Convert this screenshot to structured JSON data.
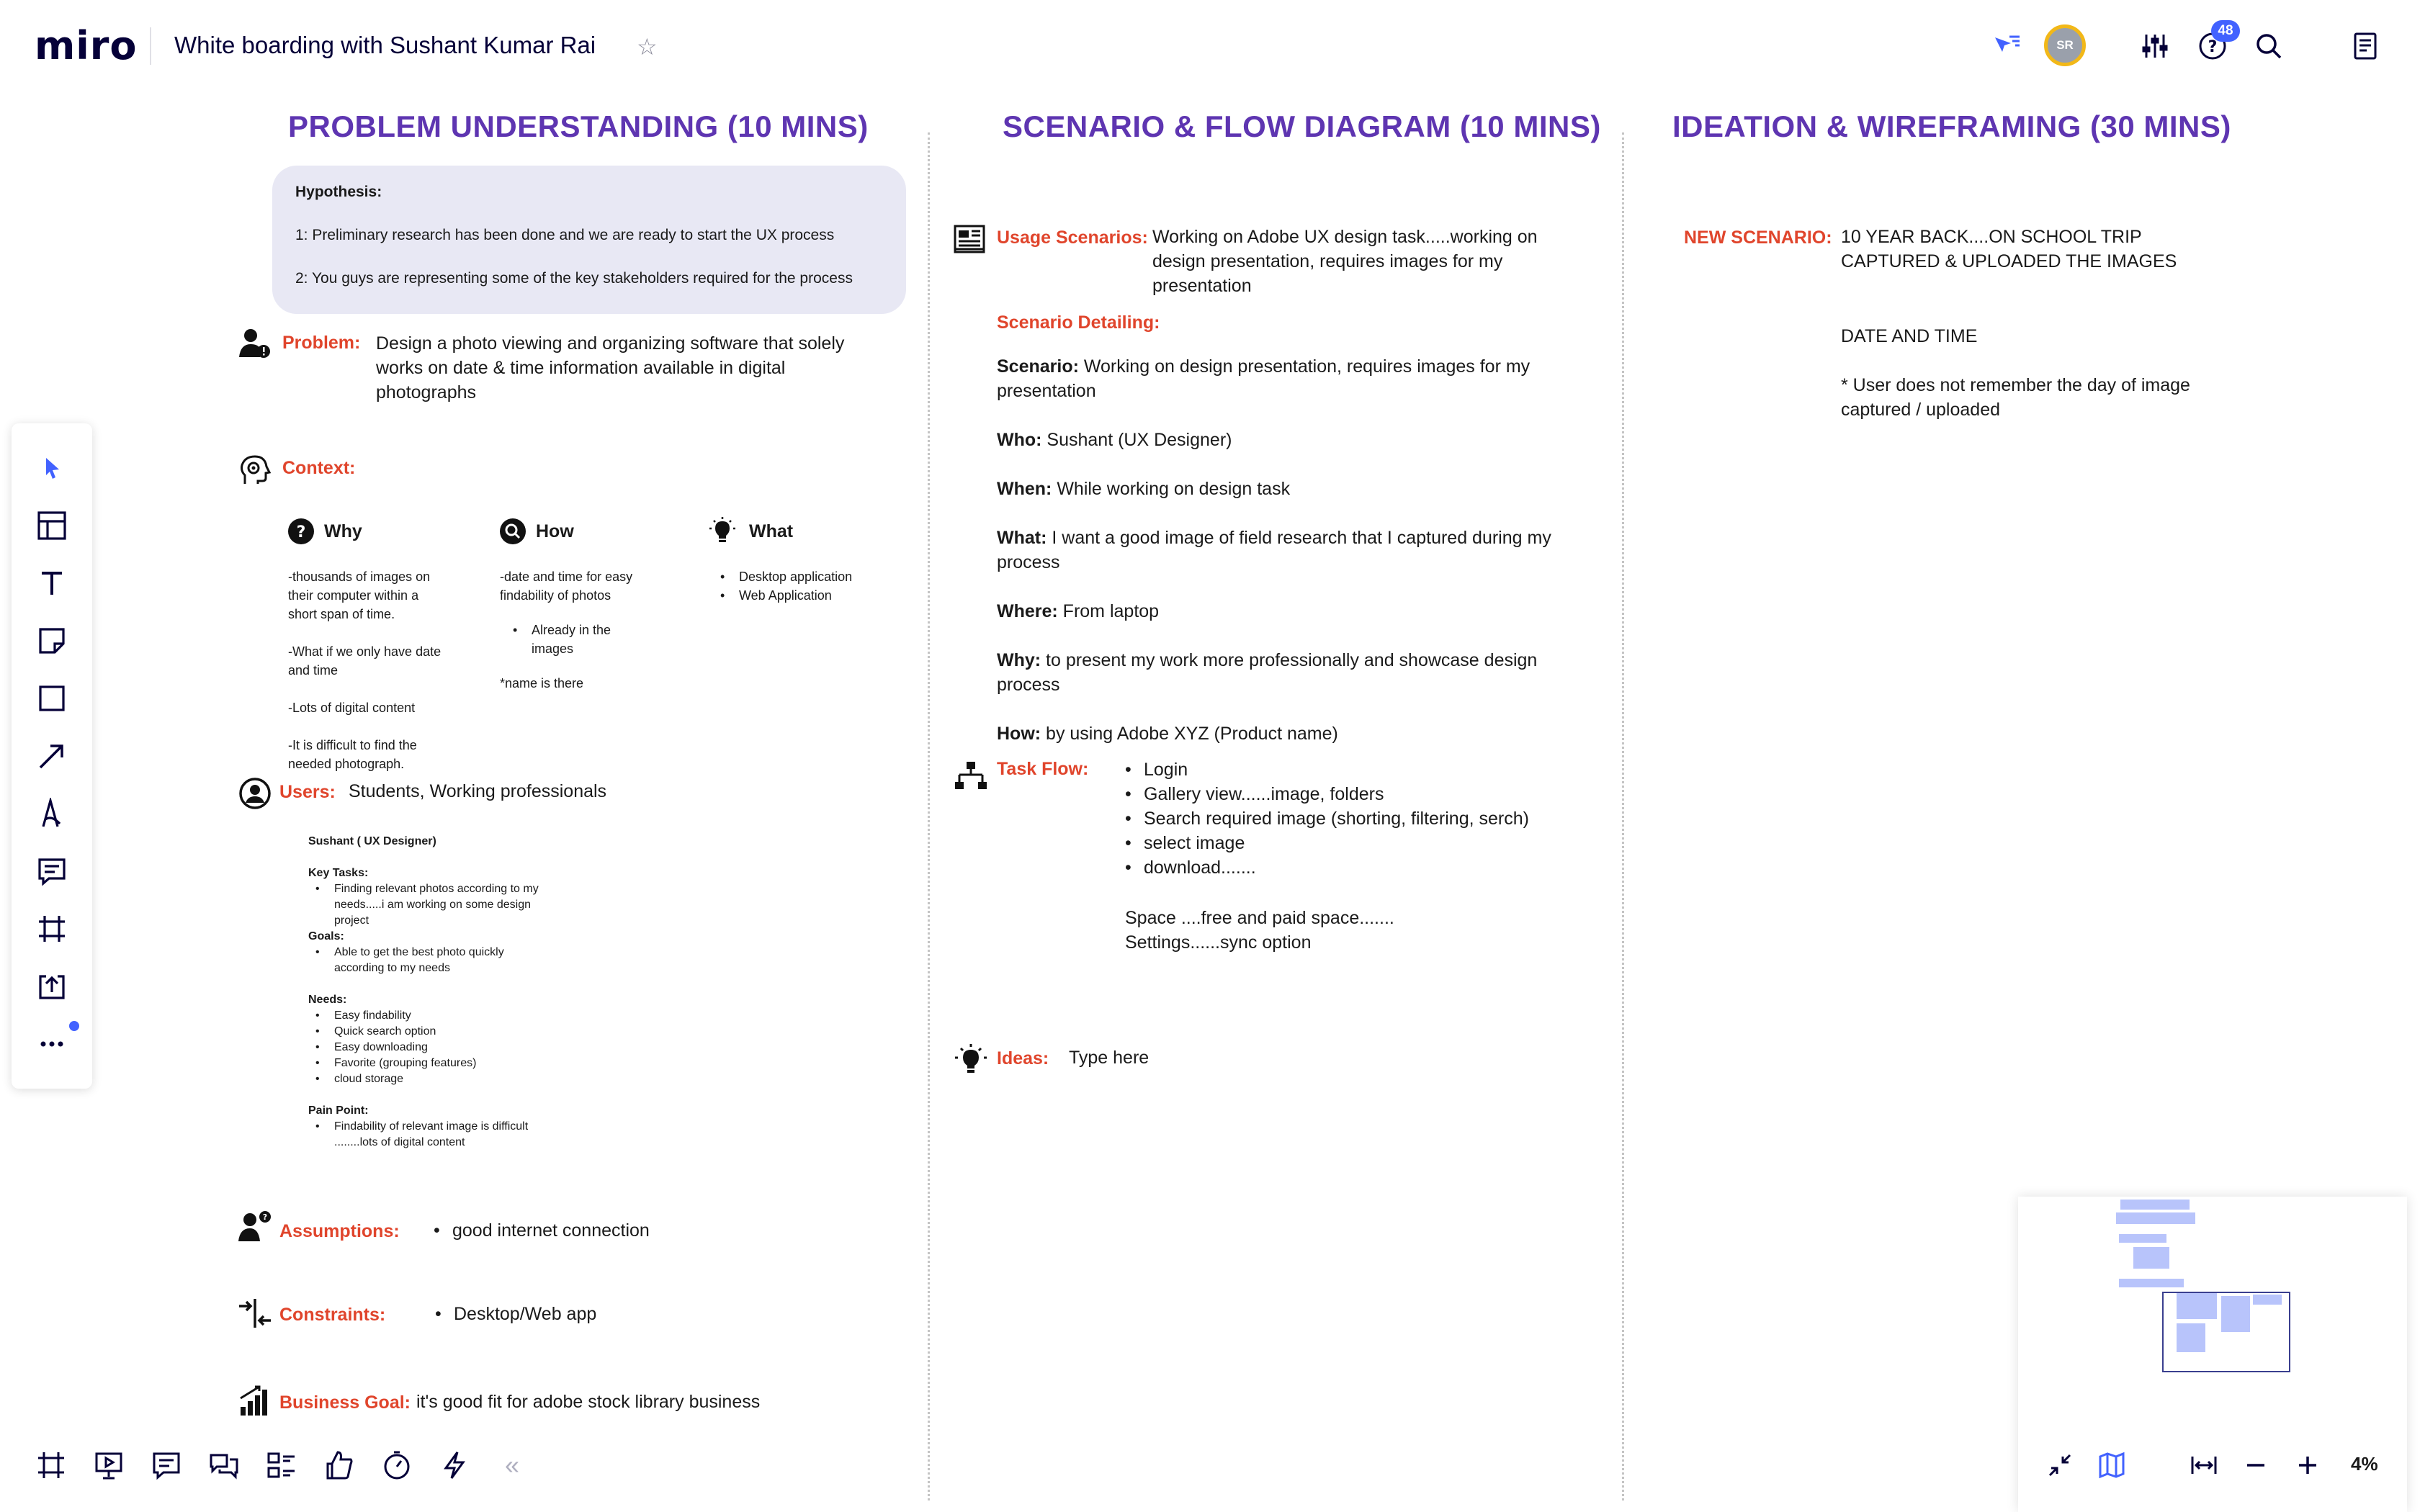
{
  "header": {
    "logo": "miro",
    "board_title": "White boarding with Sushant Kumar Rai",
    "avatar_initials": "SR",
    "notifications_count": "48"
  },
  "icons": {
    "star": "star-icon",
    "cursor_filter": "cursor-filter-icon",
    "settings": "sliders-icon",
    "help": "help-icon",
    "search": "search-icon",
    "notes": "notes-icon"
  },
  "toolbar": {
    "tools": [
      "select",
      "templates",
      "text",
      "sticky-note",
      "shape",
      "arrow",
      "pen",
      "comment",
      "frame",
      "upload",
      "more"
    ]
  },
  "bottom_toolbar": {
    "tools": [
      "frames",
      "presentation",
      "comments",
      "chat",
      "card-list",
      "reactions",
      "timer",
      "activity"
    ],
    "collapse": "«"
  },
  "zoom": {
    "level": "4%"
  },
  "colors": {
    "accent": "#4262ff",
    "section_title": "#5e35b1",
    "label": "#e0452c",
    "hypothesis_bg": "#e8e8f4"
  },
  "sections": {
    "problem": "PROBLEM UNDERSTANDING (10 MINS)",
    "scenario": "SCENARIO & FLOW DIAGRAM (10 MINS)",
    "ideation": "IDEATION & WIREFRAMING (30 MINS)"
  },
  "hypothesis": {
    "title": "Hypothesis:",
    "line1": "1: Preliminary research has been done and we are ready to start the UX process",
    "line2": "2: You guys are representing some of the key stakeholders required for the process"
  },
  "problem": {
    "label": "Problem:",
    "text": "Design a photo viewing and organizing software that solely works on date & time information available in digital photographs"
  },
  "context": {
    "label": "Context:",
    "why": {
      "title": "Why",
      "items": [
        "-thousands of images on their computer within a short span of time.",
        "-What if we only have date and time",
        "-Lots of digital content",
        "-It is difficult to find the needed photograph."
      ]
    },
    "how": {
      "title": "How",
      "text": "-date and time for easy findability of photos",
      "bullet": "Already  in the images",
      "note": "*name is there"
    },
    "what": {
      "title": "What",
      "items": [
        "Desktop application",
        "Web Application"
      ]
    }
  },
  "users": {
    "label": "Users:",
    "text": "Students, Working professionals",
    "persona": "Sushant ( UX Designer)",
    "key_tasks_title": "Key Tasks:",
    "key_tasks": [
      "Finding relevant photos according to my needs.....i am working on some design project"
    ],
    "goals_title": "Goals:",
    "goals": [
      "Able to get the best photo quickly according to my needs"
    ],
    "needs_title": "Needs:",
    "needs": [
      "Easy findability",
      "Quick search option",
      "Easy downloading",
      "Favorite (grouping features)",
      "cloud storage"
    ],
    "pain_title": "Pain Point:",
    "pain": [
      "Findability of relevant image is difficult ........lots of digital content"
    ]
  },
  "assumptions": {
    "label": "Assumptions:",
    "item": "good internet connection"
  },
  "constraints": {
    "label": "Constraints:",
    "item": "Desktop/Web app"
  },
  "business_goal": {
    "label": "Business Goal:",
    "text": "it's good fit for adobe stock library business"
  },
  "scenario": {
    "usage_label": "Usage Scenarios:",
    "usage_text": "Working on Adobe UX design task.....working on design presentation, requires images for my presentation",
    "detailing_label": "Scenario Detailing:",
    "rows": [
      {
        "k": "Scenario:",
        "v": " Working on design presentation, requires images for my presentation"
      },
      {
        "k": "Who:",
        "v": " Sushant (UX Designer)"
      },
      {
        "k": "When:",
        "v": " While working on design task"
      },
      {
        "k": "What:",
        "v": " I want a good image of field research that I captured during my process"
      },
      {
        "k": "Where:",
        "v": " From laptop"
      },
      {
        "k": "Why:",
        "v": " to present my work more professionally and showcase design process"
      },
      {
        "k": "How:",
        "v": " by using Adobe XYZ (Product name)"
      }
    ],
    "taskflow_label": "Task Flow:",
    "taskflow": [
      "Login",
      "Gallery  view......image, folders",
      "Search required image (shorting, filtering, serch)",
      "select image",
      "download......."
    ],
    "space_note": "Space ....free and paid space.......",
    "settings_note": "Settings......sync option",
    "ideas_label": "Ideas:",
    "ideas_text": "Type here"
  },
  "ideation": {
    "new_label": "NEW SCENARIO:",
    "new_text": "10 YEAR BACK....ON SCHOOL TRIP CAPTURED & UPLOADED THE IMAGES",
    "date_time": "DATE AND TIME",
    "note": "* User does not remember the day of image captured / uploaded"
  }
}
